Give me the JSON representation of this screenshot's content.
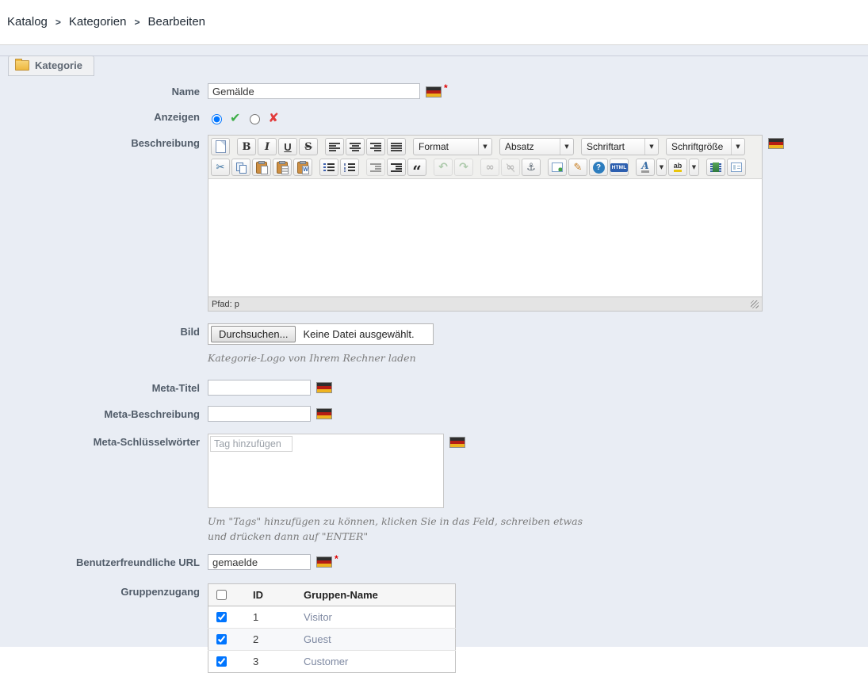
{
  "breadcrumb": {
    "separator": ">",
    "items": [
      "Katalog",
      "Kategorien",
      "Bearbeiten"
    ]
  },
  "tab": {
    "label": "Kategorie"
  },
  "form": {
    "name": {
      "label": "Name",
      "value": "Gemälde",
      "required_mark": "*"
    },
    "anzeigen": {
      "label": "Anzeigen",
      "yes_checked": true,
      "no_checked": false,
      "yes_icon": "✔",
      "no_icon": "✘"
    },
    "beschreibung": {
      "label": "Beschreibung"
    },
    "bild": {
      "label": "Bild",
      "browse_button": "Durchsuchen...",
      "no_file_text": "Keine Datei ausgewählt.",
      "help": "Kategorie-Logo von Ihrem Rechner laden"
    },
    "meta_titel": {
      "label": "Meta-Titel",
      "value": ""
    },
    "meta_beschreibung": {
      "label": "Meta-Beschreibung",
      "value": ""
    },
    "meta_schluesselwoerter": {
      "label": "Meta-Schlüsselwörter",
      "tag_placeholder": "Tag hinzufügen",
      "help": "Um \"Tags\" hinzufügen zu können, klicken Sie in das Feld, schreiben etwas und drücken dann auf \"ENTER\""
    },
    "url": {
      "label": "Benutzerfreundliche URL",
      "value": "gemaelde",
      "required_mark": "*"
    },
    "gruppenzugang": {
      "label": "Gruppenzugang",
      "select_all_checked": false,
      "columns": [
        "ID",
        "Gruppen-Name"
      ],
      "rows": [
        {
          "checked": true,
          "id": "1",
          "name": "Visitor"
        },
        {
          "checked": true,
          "id": "2",
          "name": "Guest"
        },
        {
          "checked": true,
          "id": "3",
          "name": "Customer"
        }
      ]
    }
  },
  "editor": {
    "status_path": "Pfad: p",
    "dropdowns": {
      "format": "Format",
      "paragraph": "Absatz",
      "font_family": "Schriftart",
      "font_size": "Schriftgröße"
    },
    "glyphs": {
      "bold": "B",
      "italic": "I",
      "underline": "U",
      "strikethrough": "S",
      "cut": "✂",
      "blockquote": "“",
      "undo": "↶",
      "redo": "↷",
      "link": "∞",
      "unlink": "∞",
      "anchor": "⚓",
      "cleanup": "✎",
      "help": "?",
      "html": "HTML",
      "forecolor": "A",
      "backcolor": "ab",
      "dropdown_arrow": "▼"
    }
  },
  "colors": {
    "content_bg": "#e9edf4",
    "flag_black": "#2e2e2e",
    "flag_red": "#b51d14",
    "flag_gold": "#eeb320",
    "required": "#e00000",
    "check_green": "#3fae49",
    "cross_red": "#e23b3b"
  }
}
